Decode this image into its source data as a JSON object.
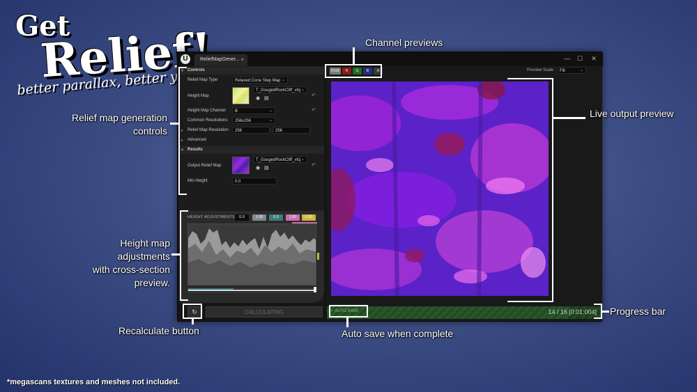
{
  "promo": {
    "title_line1": "Get",
    "title_line2": "Relief!",
    "tagline": "better parallax, better you",
    "footnote": "*megascans textures and meshes not included."
  },
  "callouts": {
    "channel_previews": "Channel previews",
    "relief_controls_1": "Relief map generation",
    "relief_controls_2": "controls",
    "live_output": "Live output preview",
    "height_adj_1": "Height map adjustments",
    "height_adj_2": "with cross-section",
    "height_adj_3": "preview.",
    "recalculate": "Recalculate button",
    "auto_save": "Auto save when complete",
    "progress_bar": "Progress bar"
  },
  "window": {
    "tab_label": "ReliefMapGener...",
    "tab_close": "×",
    "minimize": "—",
    "maximize": "☐",
    "close": "✕"
  },
  "controls": {
    "section_label": "Controls",
    "relief_map_type_label": "Relief Map Type",
    "relief_map_type_value": "Relaxed Cone Step Map",
    "height_map_label": "Height Map",
    "height_map_asset": "T_GougedRockCliff_vlcj",
    "height_map_channel_label": "Height Map Channel",
    "height_map_channel_value": "B",
    "common_res_label": "Common Resolutions",
    "common_res_value": "256x256",
    "relief_res_label": "Relief Map Resolution",
    "relief_res_x": "256",
    "relief_res_y": "256",
    "advanced_label": "Advanced"
  },
  "results": {
    "section_label": "Results",
    "output_label": "Output Relief Map",
    "output_asset": "T_GougedRockCliff_vlcj",
    "min_height_label": "Min Height",
    "min_height_value": "0.0"
  },
  "height_adjustments": {
    "title": "HEIGHT ADJUSTMENTS",
    "values": [
      "0.0",
      "1.00",
      "0.0",
      "1.00",
      "0.00"
    ],
    "colors": [
      "#0d0d0d",
      "#7d8a8f",
      "#3e7a80",
      "#c86ea8",
      "#c9b83a"
    ]
  },
  "buttons": {
    "recalculate_icon": "↻",
    "calculating": "CALCULATING"
  },
  "channels": {
    "labels": [
      "RGB",
      "R",
      "G",
      "B",
      "A"
    ],
    "colors": [
      "#7a7a7a",
      "#8a1a1a",
      "#1f6e1f",
      "#23307e",
      "#3a3a3a"
    ]
  },
  "preview": {
    "scale_label": "Preview Scale",
    "scale_value": "Fill"
  },
  "progress": {
    "auto_save": "AUTO SAVE",
    "count": "14 / 16",
    "time": "[0:01:004]",
    "fraction": 0.875
  }
}
